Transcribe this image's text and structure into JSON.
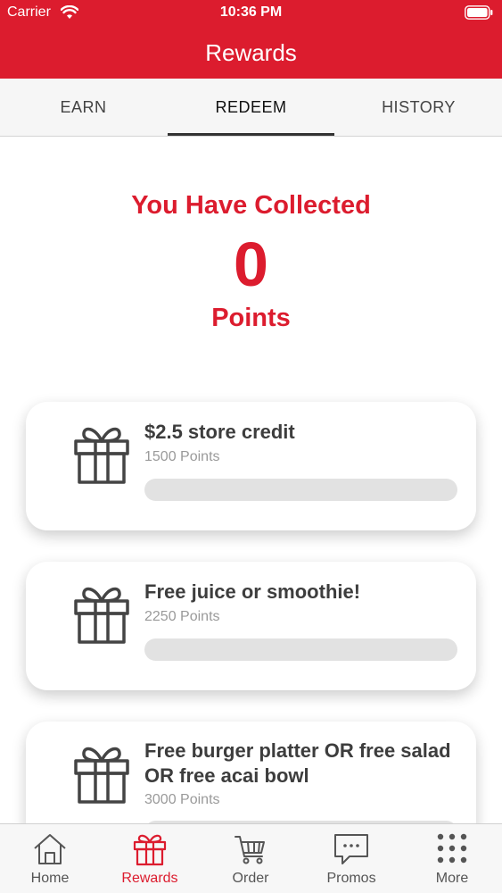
{
  "status_bar": {
    "carrier": "Carrier",
    "time": "10:36 PM"
  },
  "header": {
    "title": "Rewards"
  },
  "tabs": [
    {
      "label": "EARN"
    },
    {
      "label": "REDEEM"
    },
    {
      "label": "HISTORY"
    }
  ],
  "active_tab": "REDEEM",
  "summary": {
    "heading": "You Have Collected",
    "value": "0",
    "unit": "Points"
  },
  "rewards": [
    {
      "title": "$2.5 store credit",
      "points": "1500 Points",
      "progress": 0
    },
    {
      "title": "Free juice or smoothie!",
      "points": "2250 Points",
      "progress": 0
    },
    {
      "title": "Free burger platter OR free salad OR free acai bowl",
      "points": "3000 Points",
      "progress": 0
    }
  ],
  "bottom_nav": [
    {
      "label": "Home",
      "icon": "home-icon"
    },
    {
      "label": "Rewards",
      "icon": "gift-icon"
    },
    {
      "label": "Order",
      "icon": "cart-icon"
    },
    {
      "label": "Promos",
      "icon": "chat-icon"
    },
    {
      "label": "More",
      "icon": "grid-dots-icon"
    }
  ],
  "active_nav": "Rewards",
  "colors": {
    "brand": "#dc1c2e",
    "text_dark": "#3d3d3d",
    "text_muted": "#9a9a9a",
    "bar_track": "#e2e2e2"
  }
}
